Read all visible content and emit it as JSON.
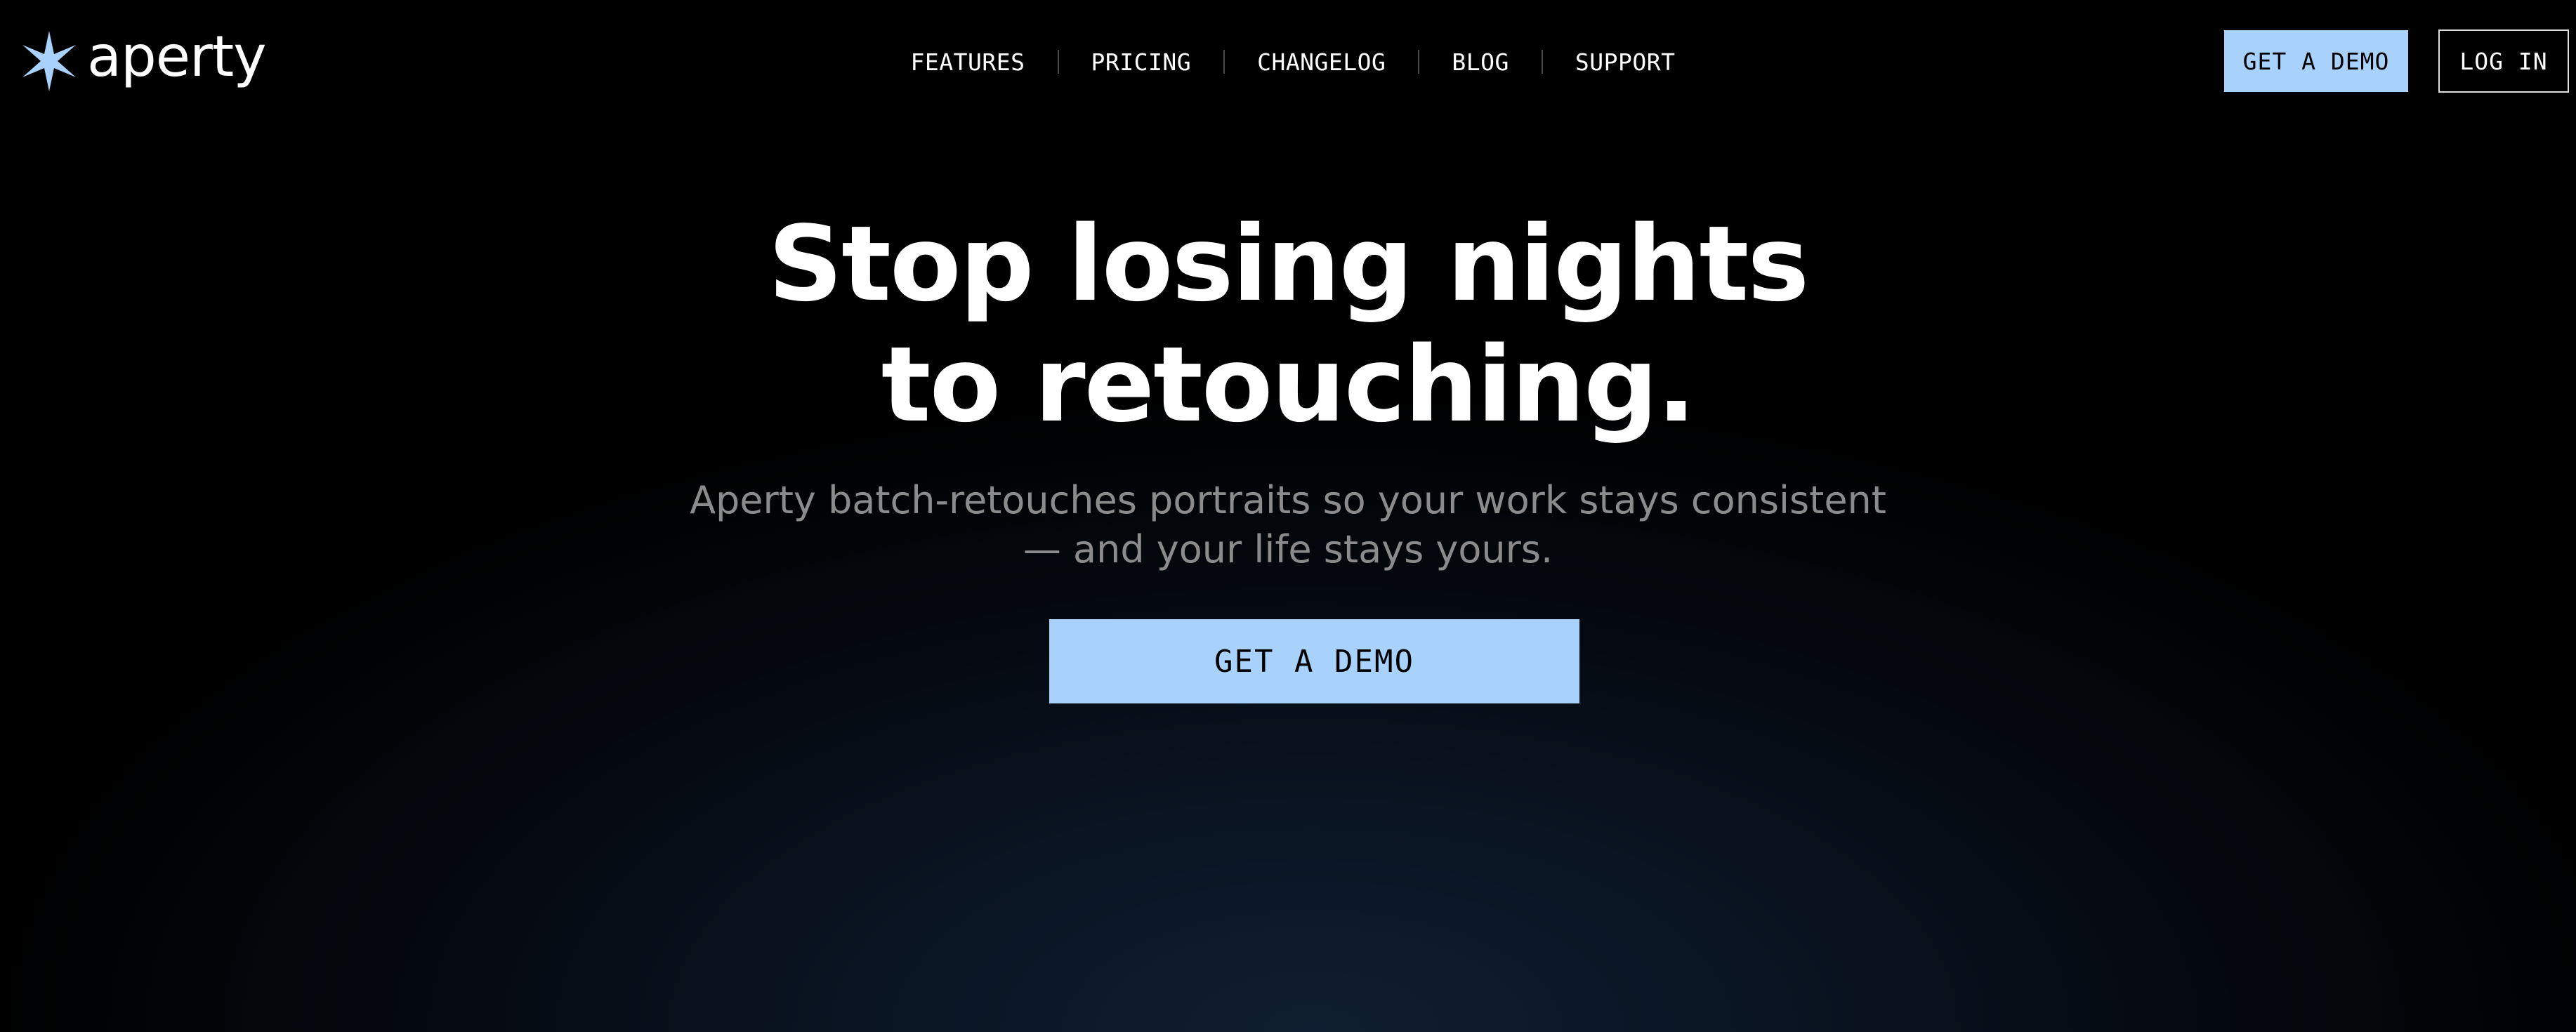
{
  "brand": {
    "name": "aperty",
    "logo_icon": "star-icon",
    "logo_color": "#a8d2fb"
  },
  "nav": {
    "items": [
      {
        "label": "FEATURES"
      },
      {
        "label": "PRICING"
      },
      {
        "label": "CHANGELOG"
      },
      {
        "label": "BLOG"
      },
      {
        "label": "SUPPORT"
      }
    ]
  },
  "header_actions": {
    "demo_label": "GET A DEMO",
    "login_label": "LOG IN"
  },
  "hero": {
    "headline_line1": "Stop losing nights",
    "headline_line2": "to retouching.",
    "subhead_line1": "Aperty batch-retouches portraits so your work stays consistent",
    "subhead_line2": "— and your life stays yours.",
    "cta_label": "GET A DEMO"
  },
  "colors": {
    "accent": "#a8d2fb",
    "background": "#000000",
    "subhead_text": "#8b8b8b"
  }
}
